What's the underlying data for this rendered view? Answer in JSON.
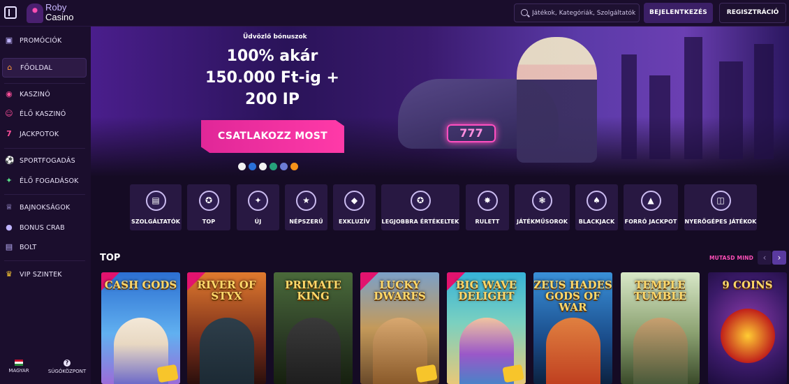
{
  "topbar": {
    "logo_line1": "Roby",
    "logo_line2": "Casino",
    "search_placeholder": "Játékok, Kategóriák, Szolgáltatók",
    "login_label": "BEJELENTKEZÉS",
    "register_label": "REGISZTRÁCIÓ"
  },
  "sidebar": {
    "items": [
      {
        "label": "PROMÓCIÓK",
        "icon": "gift-icon"
      },
      {
        "label": "FŐOLDAL",
        "icon": "home-icon"
      },
      {
        "label": "KASZINÓ",
        "icon": "chip-icon"
      },
      {
        "label": "ÉLŐ KASZINÓ",
        "icon": "dealer-icon"
      },
      {
        "label": "JACKPOTOK",
        "icon": "seven-icon"
      },
      {
        "label": "SPORTFOGADÁS",
        "icon": "football-icon"
      },
      {
        "label": "ÉLŐ FOGADÁSOK",
        "icon": "live-bet-icon"
      },
      {
        "label": "BAJNOKSÁGOK",
        "icon": "trophy-icon"
      },
      {
        "label": "BONUS CRAB",
        "icon": "crab-icon"
      },
      {
        "label": "BOLT",
        "icon": "cart-icon"
      },
      {
        "label": "VIP SZINTEK",
        "icon": "crown-icon"
      }
    ],
    "language": "MAGYAR",
    "help": "SÚGÓKÖZPONT"
  },
  "hero": {
    "subtitle": "Üdvözlő bónuszok",
    "title_line1": "100% akár",
    "title_line2": "150.000 Ft-ig +",
    "title_line3": "200 IP",
    "cta": "CSATLAKOZZ MOST",
    "neon_sign": "777"
  },
  "categories": [
    {
      "label": "SZOLGÁLTATÓK",
      "icon": "folder-icon"
    },
    {
      "label": "TOP",
      "icon": "medal-icon"
    },
    {
      "label": "ÚJ",
      "icon": "sparkle-icon"
    },
    {
      "label": "NÉPSZERŰ",
      "icon": "star-icon"
    },
    {
      "label": "EXKLUZÍV",
      "icon": "diamond-icon"
    },
    {
      "label": "LEGJOBBRA ÉRTÉKELTEK",
      "icon": "award-icon"
    },
    {
      "label": "RULETT",
      "icon": "roulette-icon"
    },
    {
      "label": "JÁTÉKMŰSOROK",
      "icon": "wheel-icon"
    },
    {
      "label": "BLACKJACK",
      "icon": "spade-icon"
    },
    {
      "label": "FORRÓ JACKPOT",
      "icon": "flame-icon"
    },
    {
      "label": "NYERŐGÉPES JÁTÉKOK",
      "icon": "slot-machine-icon"
    }
  ],
  "top_section": {
    "title": "TOP",
    "show_all": "MUTASD MIND",
    "games": [
      {
        "title": "CASH GODS"
      },
      {
        "title": "RIVER OF STYX"
      },
      {
        "title": "PRIMATE KING"
      },
      {
        "title": "LUCKY DWARFS"
      },
      {
        "title": "BIG WAVE DELIGHT"
      },
      {
        "title": "ZEUS HADES GODS OF WAR"
      },
      {
        "title": "TEMPLE TUMBLE"
      },
      {
        "title": "9 COINS"
      }
    ]
  },
  "colors": {
    "accent_pink": "#e02798",
    "panel": "#281842",
    "background": "#150b24"
  }
}
